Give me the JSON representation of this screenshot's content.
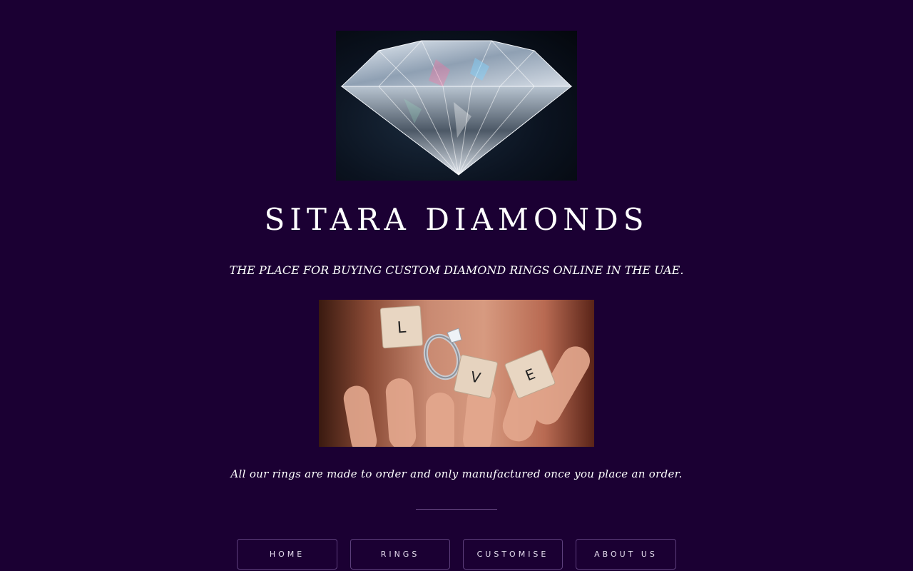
{
  "site": {
    "title": "SITARA DIAMONDS",
    "tagline": "THE PLACE FOR BUYING CUSTOM DIAMOND RINGS ONLINE IN THE UAE.",
    "note": "All our rings are made to order and only manufactured once you place an order."
  },
  "nav": {
    "home": "HOME",
    "rings": "RINGS",
    "customise": "CUSTOMISE",
    "about": "ABOUT US"
  },
  "tiles": {
    "l": "L",
    "v": "V",
    "e": "E"
  },
  "colors": {
    "background": "#1b0033",
    "text": "#ffffff",
    "nav_border": "#5d3f7c"
  }
}
